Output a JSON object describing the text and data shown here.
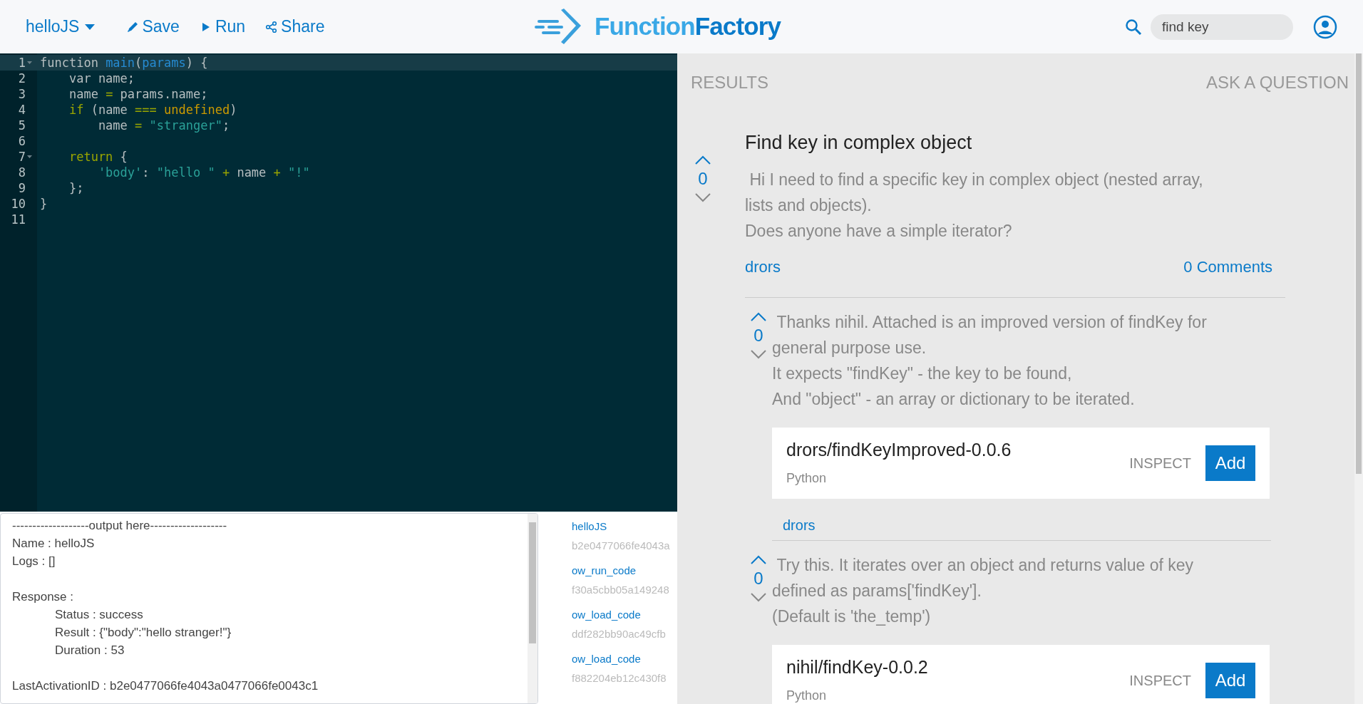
{
  "header": {
    "project": "helloJS",
    "actions": [
      {
        "kind": "save",
        "label": "Save"
      },
      {
        "kind": "run",
        "label": "Run"
      },
      {
        "kind": "share",
        "label": "Share"
      }
    ],
    "brand": [
      "Function",
      "Factory"
    ],
    "search": {
      "value": "find key"
    }
  },
  "editor": {
    "lines": [
      {
        "number": "1",
        "fold": true,
        "current": true,
        "tokens": [
          {
            "kind": "plain",
            "text": "function "
          },
          {
            "kind": "fn",
            "text": "main"
          },
          {
            "kind": "plain",
            "text": "("
          },
          {
            "kind": "fn",
            "text": "params"
          },
          {
            "kind": "plain",
            "text": ") {"
          }
        ]
      },
      {
        "number": "2",
        "fold": false,
        "current": false,
        "tokens": [
          {
            "kind": "plain",
            "text": "    var name;"
          }
        ]
      },
      {
        "number": "3",
        "fold": false,
        "current": false,
        "tokens": [
          {
            "kind": "plain",
            "text": "    name "
          },
          {
            "kind": "op",
            "text": "="
          },
          {
            "kind": "plain",
            "text": " params.name;"
          }
        ]
      },
      {
        "number": "4",
        "fold": false,
        "current": false,
        "tokens": [
          {
            "kind": "op",
            "text": "    if"
          },
          {
            "kind": "plain",
            "text": " (name "
          },
          {
            "kind": "op",
            "text": "==="
          },
          {
            "kind": "const",
            "text": " undefined"
          },
          {
            "kind": "plain",
            "text": ")"
          }
        ]
      },
      {
        "number": "5",
        "fold": false,
        "current": false,
        "tokens": [
          {
            "kind": "plain",
            "text": "        name "
          },
          {
            "kind": "op",
            "text": "="
          },
          {
            "kind": "str",
            "text": " \"stranger\""
          },
          {
            "kind": "plain",
            "text": ";"
          }
        ]
      },
      {
        "number": "6",
        "fold": false,
        "current": false
      },
      {
        "number": "7",
        "fold": true,
        "current": false,
        "tokens": [
          {
            "kind": "op",
            "text": "    return"
          },
          {
            "kind": "plain",
            "text": " {"
          }
        ]
      },
      {
        "number": "8",
        "fold": false,
        "current": false,
        "tokens": [
          {
            "kind": "str",
            "text": "        'body'"
          },
          {
            "kind": "plain",
            "text": ": "
          },
          {
            "kind": "str",
            "text": "\"hello \""
          },
          {
            "kind": "op",
            "text": " +"
          },
          {
            "kind": "plain",
            "text": " name "
          },
          {
            "kind": "op",
            "text": "+"
          },
          {
            "kind": "str",
            "text": " \"!\""
          }
        ]
      },
      {
        "number": "9",
        "fold": false,
        "current": false,
        "tokens": [
          {
            "kind": "plain",
            "text": "    };"
          }
        ]
      },
      {
        "number": "10",
        "fold": false,
        "current": false,
        "tokens": [
          {
            "kind": "plain",
            "text": "}"
          }
        ]
      },
      {
        "number": "11",
        "fold": false,
        "current": false
      }
    ]
  },
  "output": {
    "lines": [
      {
        "kind": "line",
        "text": "-------------------output here-------------------"
      },
      {
        "kind": "line",
        "text": "Name : helloJS"
      },
      {
        "kind": "line",
        "text": "Logs : []"
      },
      {
        "kind": "blank"
      },
      {
        "kind": "line",
        "text": "Response :"
      },
      {
        "kind": "indented",
        "text": "Status : success"
      },
      {
        "kind": "indented",
        "text": "Result : {\"body\":\"hello stranger!\"}"
      },
      {
        "kind": "indented",
        "text": "Duration : 53"
      },
      {
        "kind": "blank"
      },
      {
        "kind": "line",
        "text": "LastActivationID : b2e0477066fe4043a0477066fe0043c1"
      }
    ]
  },
  "activations": [
    {
      "name": "helloJS",
      "id": "b2e0477066fe4043a"
    },
    {
      "name": "ow_run_code",
      "id": "f30a5cbb05a149248"
    },
    {
      "name": "ow_load_code",
      "id": "ddf282bb90ac49cfb"
    },
    {
      "name": "ow_load_code",
      "id": "f882204eb12c430f8"
    }
  ],
  "results": {
    "tab": "RESULTS",
    "ask": "ASK A QUESTION",
    "question": {
      "title": "Find key in complex object",
      "votes": "0",
      "body": [
        " Hi I need to find a specific key in complex object (nested array, lists and objects).",
        "Does anyone have a simple iterator?"
      ],
      "author": "drors",
      "comments": "0 Comments"
    },
    "answers": [
      {
        "votes": "0",
        "body": [
          " Thanks nihil. Attached is an improved version of findKey for general purpose use.",
          "It expects \"findKey\" - the key to be found,",
          "And \"object\" - an array or dictionary to be iterated."
        ],
        "package": {
          "name": "drors/findKeyImproved-0.0.6",
          "language": "Python",
          "inspect": "INSPECT",
          "add": "Add"
        },
        "author": "drors"
      },
      {
        "votes": "0",
        "body": [
          " Try this. It iterates over an object and returns value of key defined as params['findKey'].",
          "(Default is 'the_temp')"
        ],
        "package": {
          "name": "nihil/findKey-0.0.2",
          "language": "Python",
          "inspect": "INSPECT",
          "add": "Add"
        }
      }
    ]
  }
}
